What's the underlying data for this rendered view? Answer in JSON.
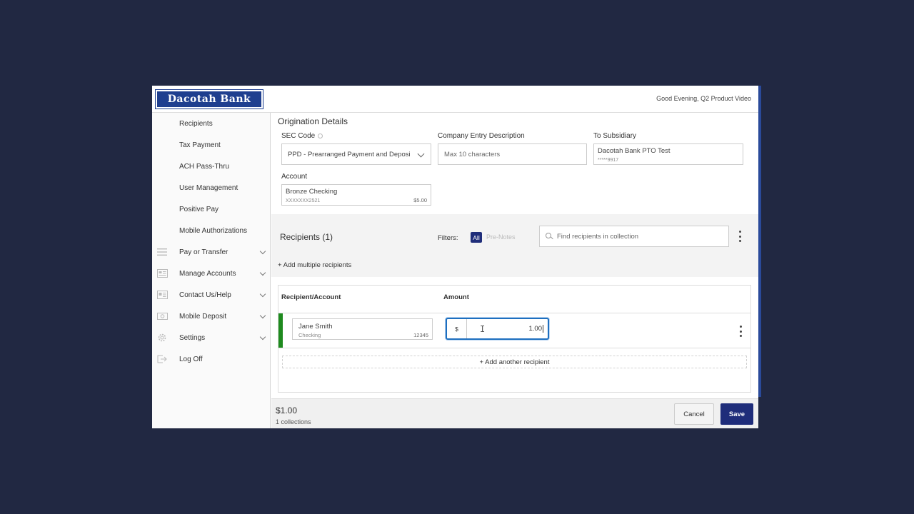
{
  "header": {
    "logo_text": "Dacotah Bank",
    "greeting": "Good Evening, Q2 Product Video"
  },
  "sidebar": {
    "items": [
      {
        "label": "Recipients",
        "icon": "",
        "expandable": false
      },
      {
        "label": "Tax Payment",
        "icon": "",
        "expandable": false
      },
      {
        "label": "ACH Pass-Thru",
        "icon": "",
        "expandable": false
      },
      {
        "label": "User Management",
        "icon": "",
        "expandable": false
      },
      {
        "label": "Positive Pay",
        "icon": "",
        "expandable": false
      },
      {
        "label": "Mobile Authorizations",
        "icon": "",
        "expandable": false
      },
      {
        "label": "Pay or Transfer",
        "icon": "menu-lines-icon",
        "expandable": true
      },
      {
        "label": "Manage Accounts",
        "icon": "accounts-icon",
        "expandable": true
      },
      {
        "label": "Contact Us/Help",
        "icon": "contact-icon",
        "expandable": true
      },
      {
        "label": "Mobile Deposit",
        "icon": "deposit-icon",
        "expandable": true
      },
      {
        "label": "Settings",
        "icon": "gear-icon",
        "expandable": true
      },
      {
        "label": "Log Off",
        "icon": "logoff-icon",
        "expandable": false
      }
    ]
  },
  "origination": {
    "title": "Origination Details",
    "sec_code": {
      "label": "SEC Code",
      "value": "PPD - Prearranged Payment and Deposi"
    },
    "company_entry": {
      "label": "Company Entry Description",
      "placeholder": "Max 10 characters"
    },
    "subsidiary": {
      "label": "To Subsidiary",
      "value": "Dacotah Bank PTO Test",
      "sub": "*****9917"
    },
    "account": {
      "label": "Account",
      "value": "Bronze Checking",
      "sub": "XXXXXXX2521",
      "balance": "$5.00"
    }
  },
  "recipients": {
    "title": "Recipients (1)",
    "filters_label": "Filters:",
    "filter_all": "All",
    "filter_prenotes": "Pre-Notes",
    "search_placeholder": "Find recipients in collection",
    "add_multiple": "+ Add multiple recipients",
    "columns": {
      "recipient": "Recipient/Account",
      "amount": "Amount"
    },
    "rows": [
      {
        "name": "Jane Smith",
        "type": "Checking",
        "account": "12345",
        "currency": "$",
        "amount": "1.00"
      }
    ],
    "add_another": "+ Add another recipient"
  },
  "footer": {
    "total": "$1.00",
    "count": "1 collections",
    "cancel": "Cancel",
    "save": "Save"
  },
  "colors": {
    "brand": "#1f3f8f",
    "primary_button": "#1f2d7a",
    "row_status": "#1e8a1e",
    "focus": "#1e6fbf"
  }
}
